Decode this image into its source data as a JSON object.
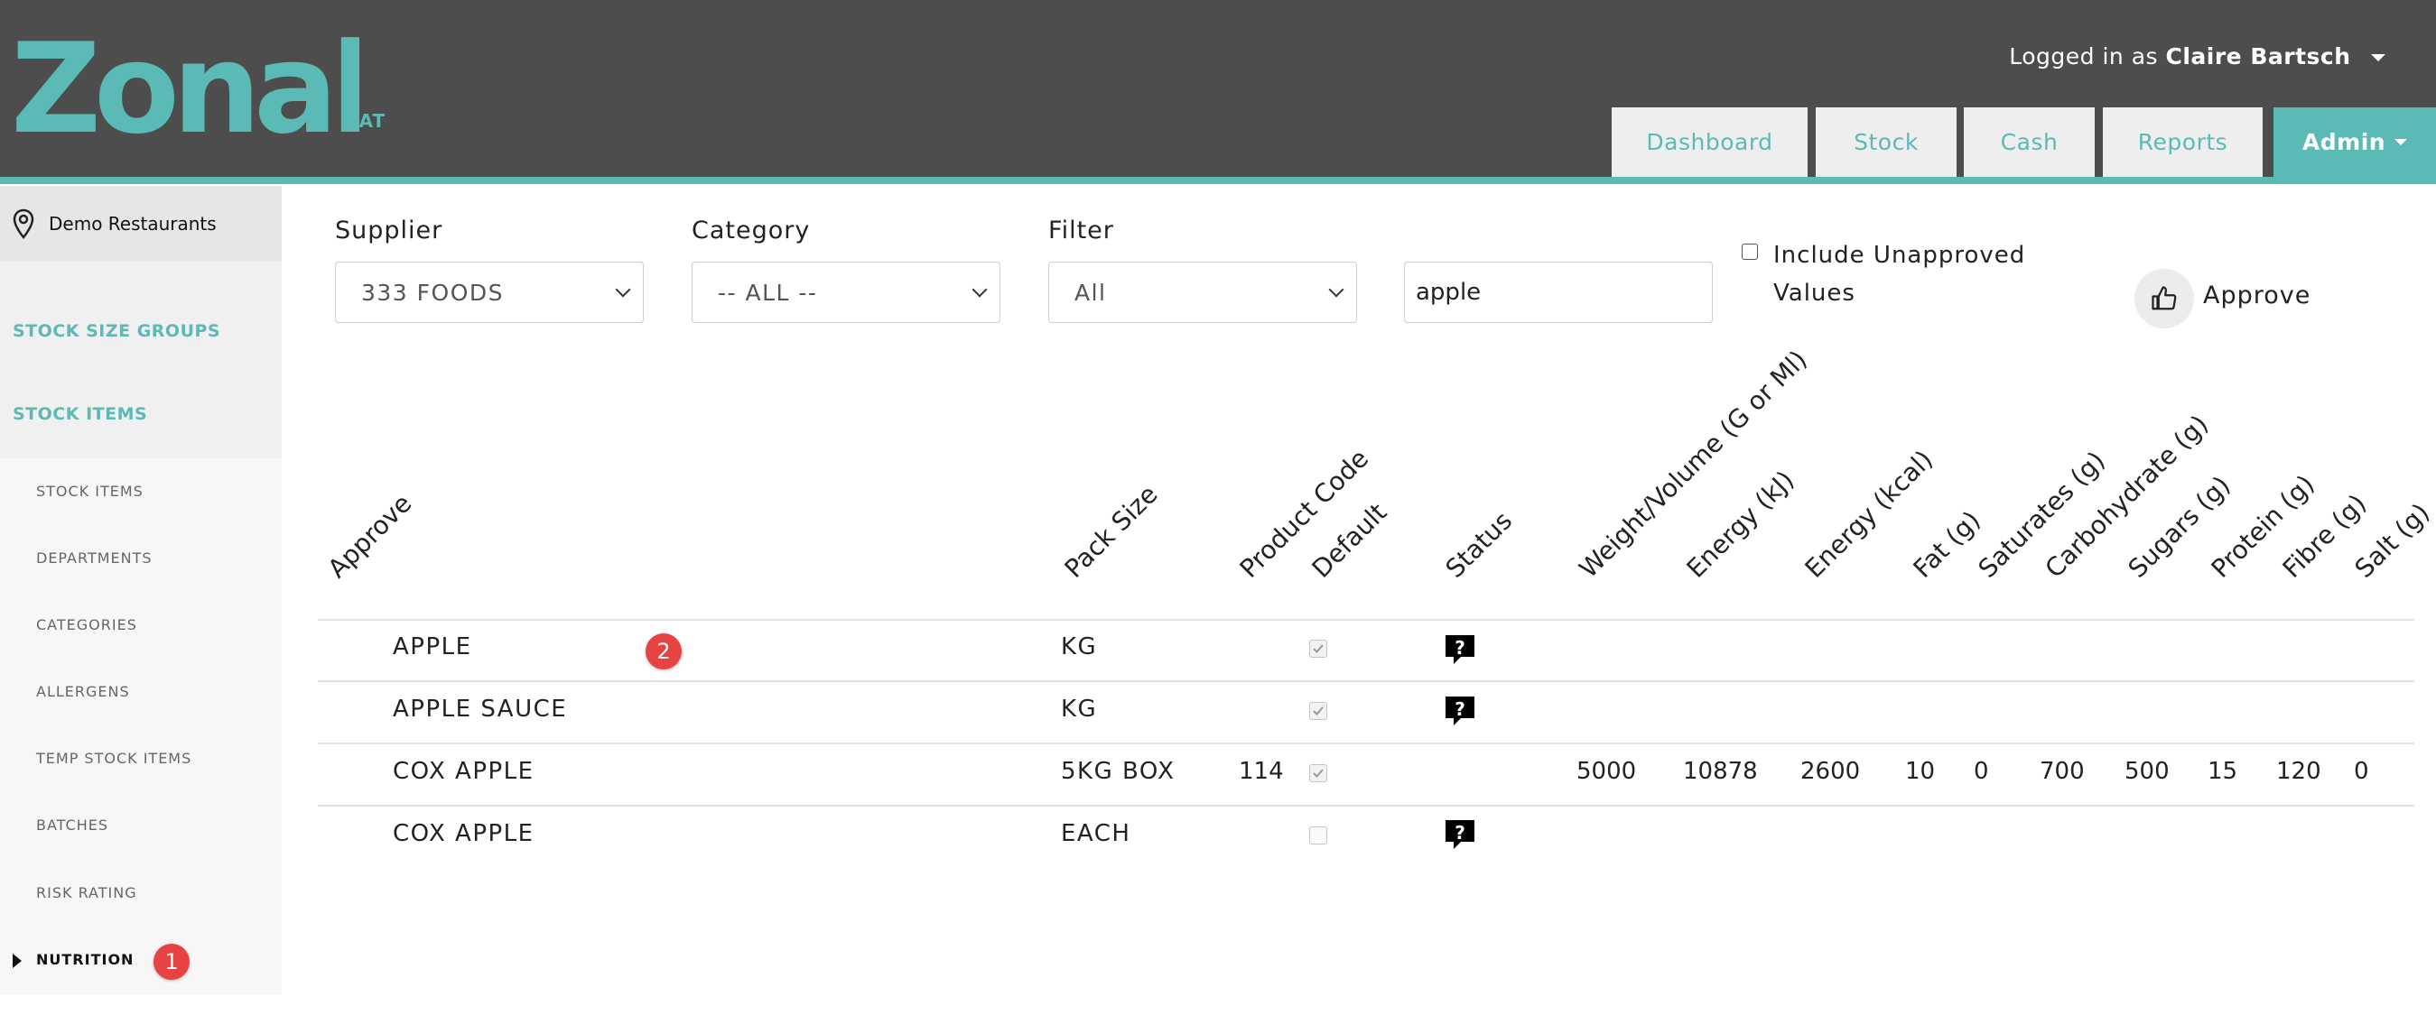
{
  "app": {
    "logo_text": "Zonal",
    "environment": "UAT",
    "user_prefix": "Logged in as",
    "user_name": "Claire Bartsch"
  },
  "nav": {
    "dashboard": "Dashboard",
    "stock": "Stock",
    "cash": "Cash",
    "reports": "Reports",
    "admin": "Admin"
  },
  "sidebar": {
    "location": "Demo Restaurants",
    "stock_size_groups": "STOCK SIZE GROUPS",
    "stock_items": "STOCK ITEMS",
    "sub_items": [
      "STOCK ITEMS",
      "DEPARTMENTS",
      "CATEGORIES",
      "ALLERGENS",
      "TEMP STOCK ITEMS",
      "BATCHES",
      "RISK RATING",
      "NUTRITION"
    ],
    "active_sub": "NUTRITION"
  },
  "filters": {
    "supplier_label": "Supplier",
    "supplier_value": "333 FOODS",
    "category_label": "Category",
    "category_value": "-- ALL --",
    "filter_label": "Filter",
    "filter_value": "All",
    "search_value": "apple",
    "include_unapproved_label": "Include Unapproved Values",
    "include_unapproved_checked": false,
    "approve_label": "Approve"
  },
  "table": {
    "headers": {
      "approve": "Approve",
      "pack_size": "Pack Size",
      "product_code": "Product Code",
      "default": "Default",
      "status": "Status",
      "weight": "Weight/Volume (G or Ml)",
      "energy_kj": "Energy (kJ)",
      "energy_kcal": "Energy (kcal)",
      "fat": "Fat (g)",
      "saturates": "Saturates (g)",
      "carbohydrate": "Carbohydrate (g)",
      "sugars": "Sugars (g)",
      "protein": "Protein (g)",
      "fibre": "Fibre (g)",
      "salt": "Salt (g)"
    },
    "rows": [
      {
        "name": "APPLE",
        "pack_size": "KG",
        "product_code": "",
        "default": true,
        "status": "unknown",
        "weight": "",
        "energy_kj": "",
        "energy_kcal": "",
        "fat": "",
        "saturates": "",
        "carbohydrate": "",
        "sugars": "",
        "protein": "",
        "fibre": "",
        "salt": ""
      },
      {
        "name": "APPLE SAUCE",
        "pack_size": "KG",
        "product_code": "",
        "default": true,
        "status": "unknown",
        "weight": "",
        "energy_kj": "",
        "energy_kcal": "",
        "fat": "",
        "saturates": "",
        "carbohydrate": "",
        "sugars": "",
        "protein": "",
        "fibre": "",
        "salt": ""
      },
      {
        "name": "COX APPLE",
        "pack_size": "5KG BOX",
        "product_code": "114",
        "default": true,
        "status": "",
        "weight": "5000",
        "energy_kj": "10878",
        "energy_kcal": "2600",
        "fat": "10",
        "saturates": "0",
        "carbohydrate": "700",
        "sugars": "500",
        "protein": "15",
        "fibre": "120",
        "salt": "0"
      },
      {
        "name": "COX APPLE",
        "pack_size": "EACH",
        "product_code": "",
        "default": false,
        "status": "unknown",
        "weight": "",
        "energy_kj": "",
        "energy_kcal": "",
        "fat": "",
        "saturates": "",
        "carbohydrate": "",
        "sugars": "",
        "protein": "",
        "fibre": "",
        "salt": ""
      }
    ]
  },
  "annotations": {
    "badge_1": "1",
    "badge_2": "2"
  },
  "colors": {
    "header_bg": "#4d4d4d",
    "accent": "#5bbab6",
    "badge": "#e84343"
  }
}
